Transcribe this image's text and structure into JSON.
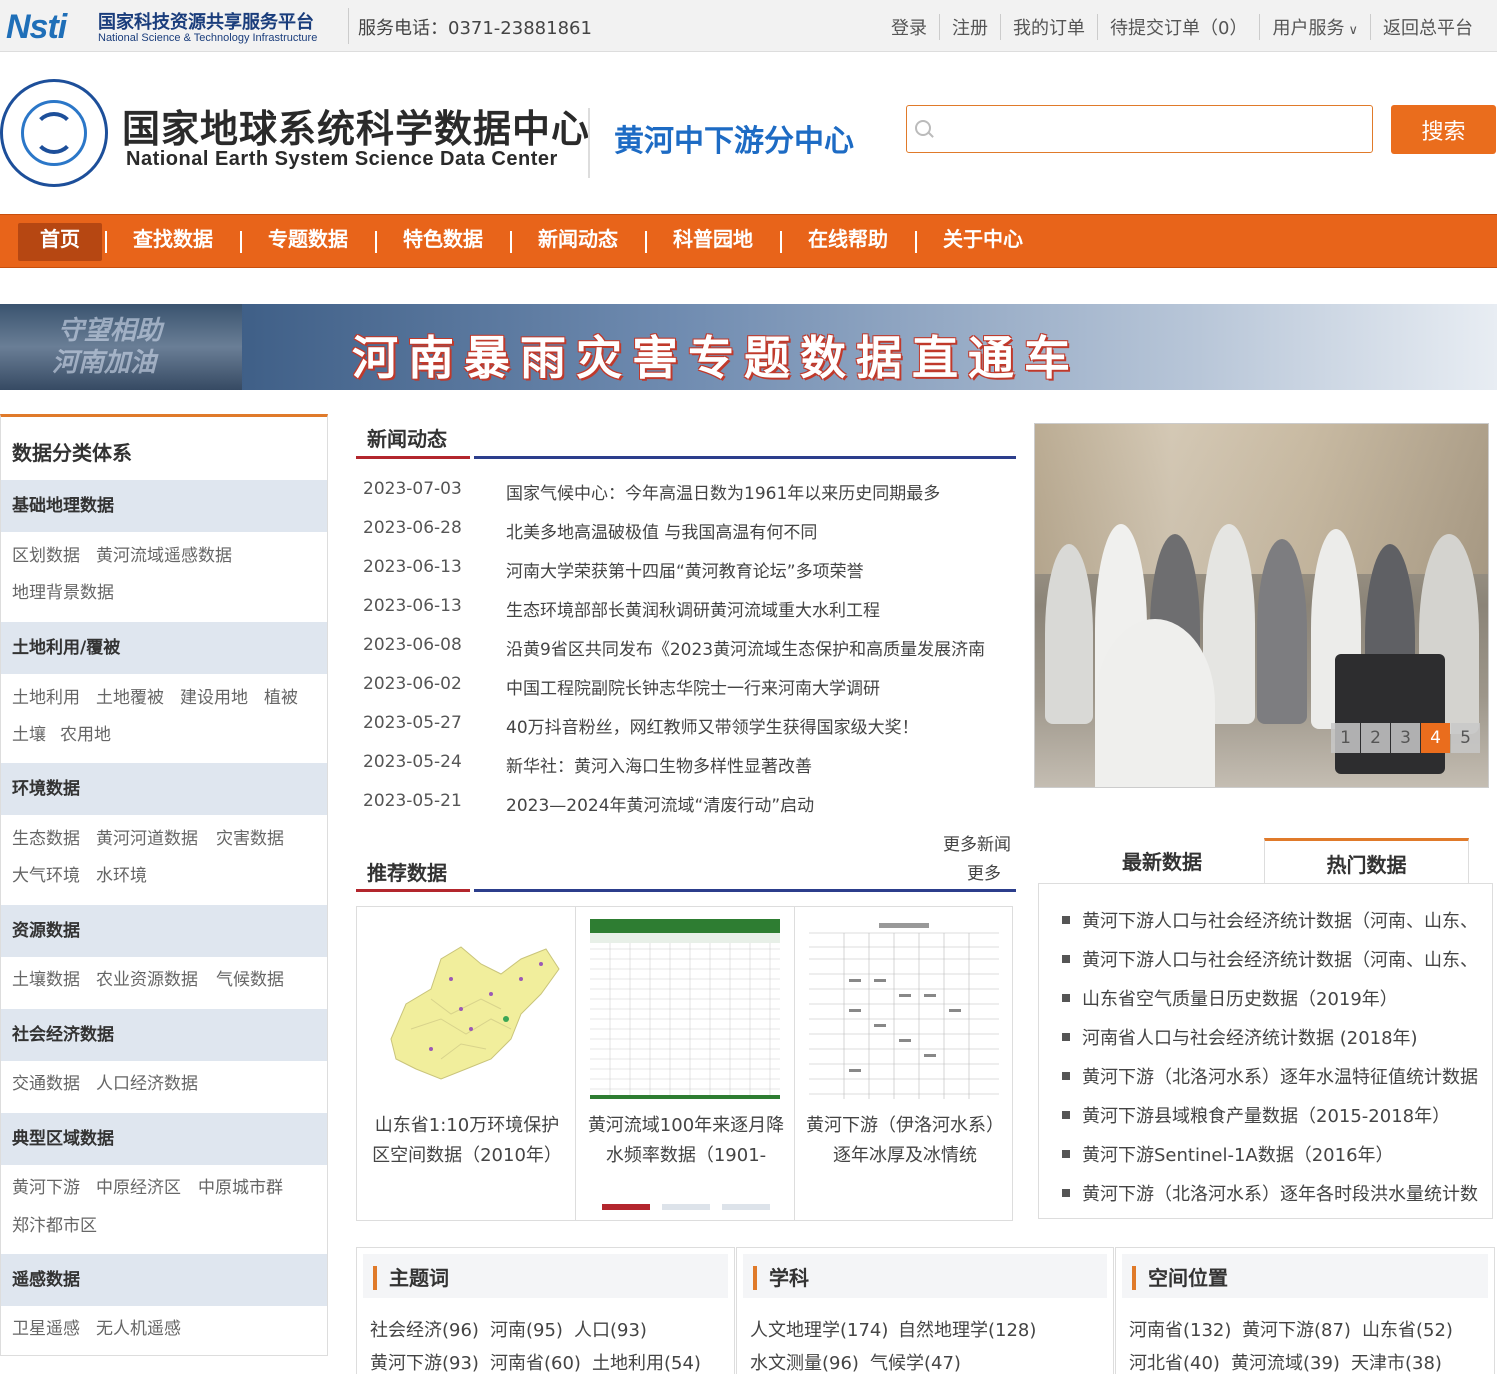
{
  "topbar": {
    "logo_mark": "Nsti",
    "logo_cn": "国家科技资源共享服务平台",
    "logo_en": "National Science & Technology Infrastructure",
    "hotline": "服务电话：0371-23881861",
    "links": [
      "登录",
      "注册",
      "我的订单",
      "待提交订单（0）",
      "用户服务",
      "返回总平台"
    ]
  },
  "header": {
    "center_cn": "国家地球系统科学数据中心",
    "center_en": "National Earth System Science Data Center",
    "branch": "黄河中下游分中心",
    "search_placeholder": "",
    "search_button": "搜索"
  },
  "nav": {
    "items": [
      "首页",
      "查找数据",
      "专题数据",
      "特色数据",
      "新闻动态",
      "科普园地",
      "在线帮助",
      "关于中心"
    ],
    "active": "首页"
  },
  "banner": {
    "slogan_line1": "守望相助",
    "slogan_line2": "河南加油",
    "title": "河南暴雨灾害专题数据直通车"
  },
  "sidebar": {
    "title": "数据分类体系",
    "categories": [
      {
        "name": "基础地理数据",
        "links": [
          [
            "区划数据",
            "黄河流域遥感数据"
          ],
          [
            "地理背景数据"
          ]
        ]
      },
      {
        "name": "土地利用/覆被",
        "links": [
          [
            "土地利用",
            "土地覆被",
            "建设用地",
            "植被"
          ],
          [
            "土壤",
            "农用地"
          ]
        ]
      },
      {
        "name": "环境数据",
        "links": [
          [
            "生态数据",
            "黄河河道数据",
            "灾害数据"
          ],
          [
            "大气环境",
            "水环境"
          ]
        ]
      },
      {
        "name": "资源数据",
        "links": [
          [
            "土壤数据",
            "农业资源数据",
            "气候数据"
          ]
        ]
      },
      {
        "name": "社会经济数据",
        "links": [
          [
            "交通数据",
            "人口经济数据"
          ]
        ]
      },
      {
        "name": "典型区域数据",
        "links": [
          [
            "黄河下游",
            "中原经济区",
            "中原城市群"
          ],
          [
            "郑汴都市区"
          ]
        ]
      },
      {
        "name": "遥感数据",
        "links": [
          [
            "卫星遥感",
            "无人机遥感"
          ]
        ]
      }
    ]
  },
  "news": {
    "heading": "新闻动态",
    "items": [
      {
        "date": "2023-07-03",
        "title": "国家气候中心：今年高温日数为1961年以来历史同期最多"
      },
      {
        "date": "2023-06-28",
        "title": "北美多地高温破极值 与我国高温有何不同"
      },
      {
        "date": "2023-06-13",
        "title": "河南大学荣获第十四届“黄河教育论坛”多项荣誉"
      },
      {
        "date": "2023-06-13",
        "title": "生态环境部部长黄润秋调研黄河流域重大水利工程"
      },
      {
        "date": "2023-06-08",
        "title": "沿黄9省区共同发布《2023黄河流域生态保护和高质量发展济南"
      },
      {
        "date": "2023-06-02",
        "title": "中国工程院副院长钟志华院士一行来河南大学调研"
      },
      {
        "date": "2023-05-27",
        "title": "40万抖音粉丝，网红教师又带领学生获得国家级大奖！"
      },
      {
        "date": "2023-05-24",
        "title": "新华社：黄河入海口生物多样性显著改善"
      },
      {
        "date": "2023-05-21",
        "title": "2023—2024年黄河流域“清废行动”启动"
      }
    ],
    "more": "更多新闻"
  },
  "slideshow": {
    "pages": [
      "1",
      "2",
      "3",
      "4",
      "5"
    ],
    "active_page": "4"
  },
  "recommended": {
    "heading": "推荐数据",
    "more": "更多",
    "cards": [
      {
        "caption": "山东省1:10万环境保护区空间数据（2010年）"
      },
      {
        "caption": "黄河流域100年来逐月降水频率数据（1901-"
      },
      {
        "caption": "黄河下游（伊洛河水系）逐年冰厚及冰情统"
      }
    ],
    "active_dot": 0
  },
  "data_tabs": {
    "tabs": [
      "最新数据",
      "热门数据"
    ],
    "active": "热门数据",
    "hot_items": [
      "黄河下游人口与社会经济统计数据（河南、山东、",
      "黄河下游人口与社会经济统计数据（河南、山东、",
      "山东省空气质量日历史数据（2019年）",
      "河南省人口与社会经济统计数据 (2018年)",
      "黄河下游（北洛河水系）逐年水温特征值统计数据",
      "黄河下游县域粮食产量数据（2015-2018年）",
      "黄河下游Sentinel-1A数据（2016年）",
      "黄河下游（北洛河水系）逐年各时段洪水量统计数"
    ]
  },
  "facets": {
    "keywords": {
      "title": "主题词",
      "rows": [
        [
          "社会经济(96)",
          "河南(95)",
          "人口(93)"
        ],
        [
          "黄河下游(93)",
          "河南省(60)",
          "土地利用(54)"
        ]
      ]
    },
    "subjects": {
      "title": "学科",
      "rows": [
        [
          "人文地理学(174)",
          "自然地理学(128)"
        ],
        [
          "水文测量(96)",
          "气候学(47)"
        ]
      ]
    },
    "locations": {
      "title": "空间位置",
      "rows": [
        [
          "河南省(132)",
          "黄河下游(87)",
          "山东省(52)"
        ],
        [
          "河北省(40)",
          "黄河流域(39)",
          "天津市(38)"
        ]
      ]
    }
  }
}
